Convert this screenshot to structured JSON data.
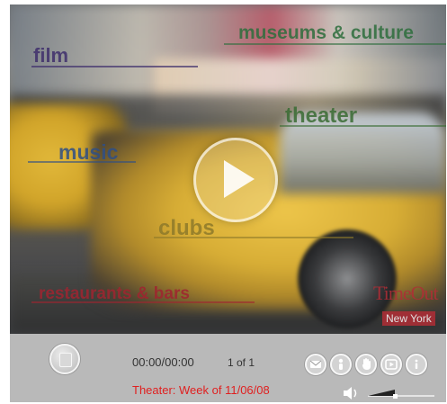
{
  "video": {
    "tags": {
      "museums": "museums & culture",
      "film": "film",
      "theater": "theater",
      "music": "music",
      "clubs": "clubs",
      "restaurants": "restaurants & bars"
    },
    "logo": {
      "brand": "TimeOut",
      "city": "New York"
    }
  },
  "controls": {
    "time": "00:00/00:00",
    "count": "1 of 1",
    "caption": "Theater: Week of 11/06/08",
    "icons": [
      "mail-icon",
      "info-person-icon",
      "hand-icon",
      "play-small-icon",
      "info-icon"
    ],
    "volume_level": 0.4
  },
  "colors": {
    "caption": "#e02020",
    "control_bar": "#b9b9b9"
  }
}
